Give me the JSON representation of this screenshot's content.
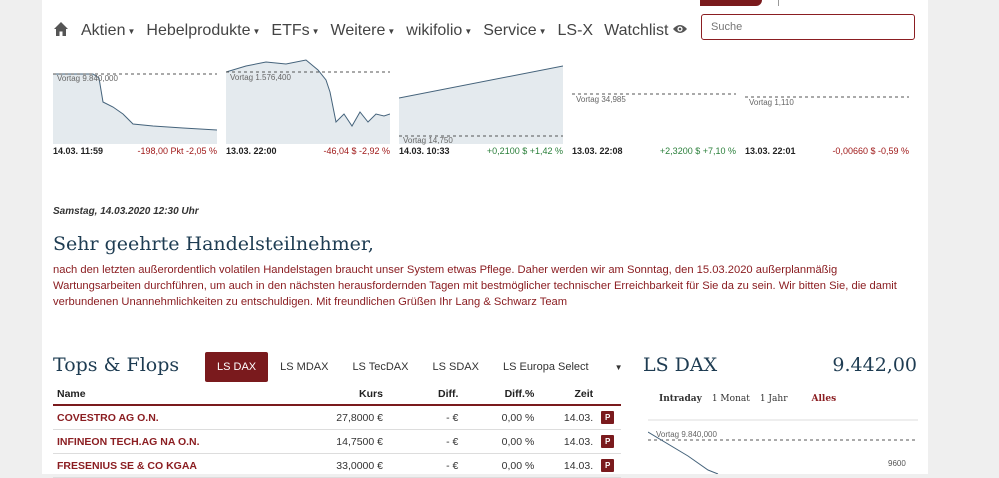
{
  "search": {
    "placeholder": "Suche"
  },
  "nav": {
    "items": [
      {
        "label": "Aktien",
        "caret": true
      },
      {
        "label": "Hebelprodukte",
        "caret": true
      },
      {
        "label": "ETFs",
        "caret": true
      },
      {
        "label": "Weitere",
        "caret": true
      },
      {
        "label": "wikifolio",
        "caret": true
      },
      {
        "label": "Service",
        "caret": true
      },
      {
        "label": "LS-X",
        "caret": false
      },
      {
        "label": "Watchlist",
        "caret": false
      }
    ],
    "home_icon": "home-icon",
    "watchlist_icon": "eye-icon"
  },
  "tickers": [
    {
      "prev_label": "Vortag 9.840,000",
      "date": "14.03. 11:59",
      "change": "-198,00 Pkt -2,05 %",
      "direction": "down"
    },
    {
      "prev_label": "Vortag 1.576,400",
      "date": "13.03. 22:00",
      "change": "-46,04 $ -2,92 %",
      "direction": "down"
    },
    {
      "prev_label": "Vortag 14,750",
      "date": "14.03. 10:33",
      "change": "+0,2100 $ +1,42 %",
      "direction": "up"
    },
    {
      "prev_label": "Vortag 34,985",
      "date": "13.03. 22:08",
      "change": "+2,3200 $ +7,10 %",
      "direction": "up"
    },
    {
      "prev_label": "Vortag 1,110",
      "date": "13.03. 22:01",
      "change": "-0,00660 $ -0,59 %",
      "direction": "down"
    }
  ],
  "notice": {
    "timestamp": "Samstag, 14.03.2020 12:30 Uhr",
    "title": "Sehr geehrte Handelsteilnehmer,",
    "body": "nach den letzten außerordentlich volatilen Handelstagen braucht unser System etwas Pflege. Daher werden wir am Sonntag, den 15.03.2020 außerplanmäßig Wartungsarbeiten durchführen, um auch in den nächsten herausfordernden Tagen mit bestmöglicher technischer Erreichbarkeit für Sie da zu sein. Wir bitten Sie, die damit verbundenen Unannehmlichkeiten zu entschuldigen. Mit freundlichen Grüßen Ihr Lang & Schwarz Team"
  },
  "tops_flops": {
    "title": "Tops & Flops",
    "tabs": [
      "LS DAX",
      "LS MDAX",
      "LS TecDAX",
      "LS SDAX",
      "LS Europa Select"
    ],
    "active_tab": "LS DAX",
    "columns": [
      "Name",
      "Kurs",
      "Diff.",
      "Diff.%",
      "Zeit"
    ],
    "rows": [
      {
        "name": "COVESTRO AG O.N.",
        "kurs": "27,8000 €",
        "diff": "- €",
        "diff_pct": "0,00 %",
        "zeit": "14.03.",
        "badge": "P"
      },
      {
        "name": "INFINEON TECH.AG NA O.N.",
        "kurs": "14,7500 €",
        "diff": "- €",
        "diff_pct": "0,00 %",
        "zeit": "14.03.",
        "badge": "P"
      },
      {
        "name": "FRESENIUS SE & CO KGAA",
        "kurs": "33,0000 €",
        "diff": "- €",
        "diff_pct": "0,00 %",
        "zeit": "14.03.",
        "badge": "P"
      }
    ]
  },
  "lsdax": {
    "title": "LS DAX",
    "value": "9.442,00",
    "ranges": [
      "Intraday",
      "1 Monat",
      "1 Jahr"
    ],
    "range_all": "Alles",
    "active_range": "Intraday",
    "prev_label": "Vortag 9.840,000",
    "axis_tick": "9600"
  },
  "colors": {
    "accent": "#7a1a1d",
    "heading": "#1e3c52",
    "negative": "#a01a1a",
    "positive": "#2a7f3a"
  }
}
